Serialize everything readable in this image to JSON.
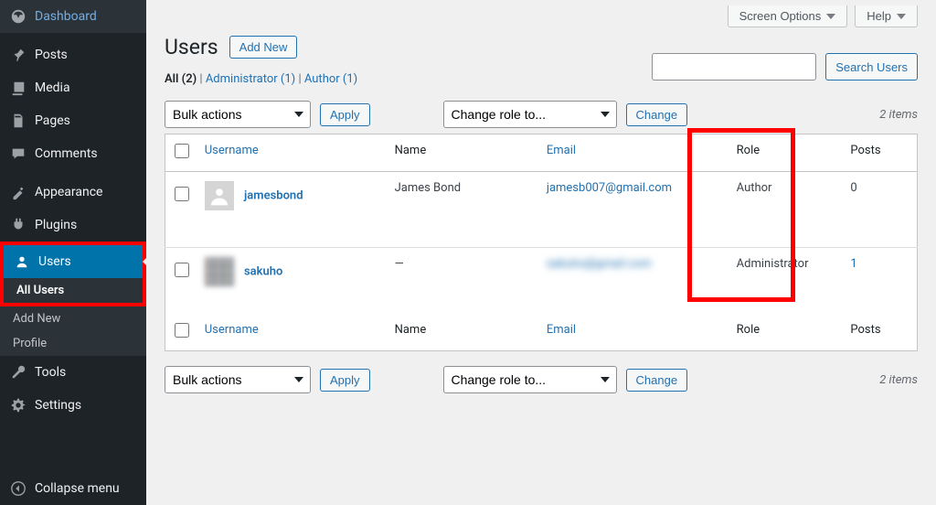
{
  "sidebar": {
    "items": [
      {
        "label": "Dashboard",
        "icon": "dashboard"
      },
      {
        "label": "Posts",
        "icon": "pin"
      },
      {
        "label": "Media",
        "icon": "media"
      },
      {
        "label": "Pages",
        "icon": "pages"
      },
      {
        "label": "Comments",
        "icon": "comments"
      },
      {
        "label": "Appearance",
        "icon": "appearance"
      },
      {
        "label": "Plugins",
        "icon": "plugins"
      },
      {
        "label": "Users",
        "icon": "users"
      },
      {
        "label": "Tools",
        "icon": "tools"
      },
      {
        "label": "Settings",
        "icon": "settings"
      }
    ],
    "subitems": [
      {
        "label": "All Users"
      },
      {
        "label": "Add New"
      },
      {
        "label": "Profile"
      }
    ],
    "collapse_label": "Collapse menu"
  },
  "topbar": {
    "screen_options": "Screen Options",
    "help": "Help"
  },
  "page": {
    "title": "Users",
    "add_new": "Add New"
  },
  "filters": {
    "all_label": "All",
    "all_count": "(2)",
    "admin_label": "Administrator",
    "admin_count": "(1)",
    "author_label": "Author",
    "author_count": "(1)",
    "sep": " | "
  },
  "search": {
    "button": "Search Users"
  },
  "tablenav": {
    "bulk": "Bulk actions",
    "apply": "Apply",
    "change_role": "Change role to...",
    "change": "Change",
    "items_count": "2 items"
  },
  "columns": {
    "username": "Username",
    "name": "Name",
    "email": "Email",
    "role": "Role",
    "posts": "Posts"
  },
  "rows": [
    {
      "username": "jamesbond",
      "name": "James Bond",
      "email": "jamesb007@gmail.com",
      "email_blurred": false,
      "role": "Author",
      "posts": "0",
      "posts_link": false,
      "avatar": "default"
    },
    {
      "username": "sakuho",
      "name": "—",
      "email": "sakuho@gmail.com",
      "email_blurred": true,
      "role": "Administrator",
      "posts": "1",
      "posts_link": true,
      "avatar": "pixel"
    }
  ]
}
